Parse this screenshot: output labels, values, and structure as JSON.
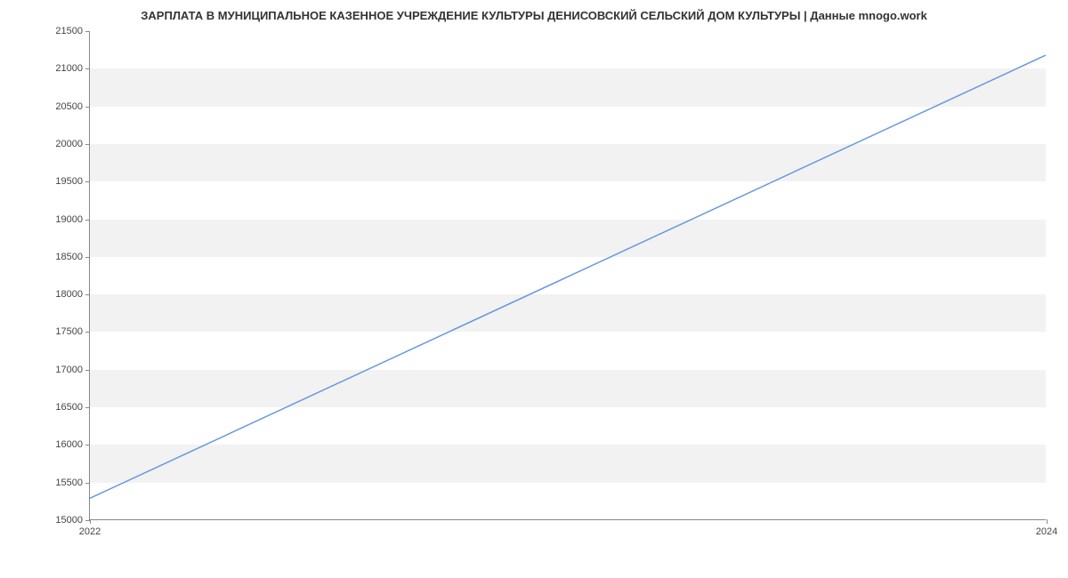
{
  "chart_data": {
    "type": "line",
    "title": "ЗАРПЛАТА В МУНИЦИПАЛЬНОЕ КАЗЕННОЕ УЧРЕЖДЕНИЕ КУЛЬТУРЫ ДЕНИСОВСКИЙ СЕЛЬСКИЙ ДОМ КУЛЬТУРЫ | Данные mnogo.work",
    "xlabel": "",
    "ylabel": "",
    "x": [
      2022,
      2024
    ],
    "values": [
      15280,
      21180
    ],
    "y_ticks": [
      15000,
      15500,
      16000,
      16500,
      17000,
      17500,
      18000,
      18500,
      19000,
      19500,
      20000,
      20500,
      21000,
      21500
    ],
    "x_ticks": [
      2022,
      2024
    ],
    "ylim": [
      15000,
      21500
    ],
    "xlim": [
      2022,
      2024
    ],
    "line_color": "#6699dd",
    "grid_band_color": "#f2f2f2"
  }
}
